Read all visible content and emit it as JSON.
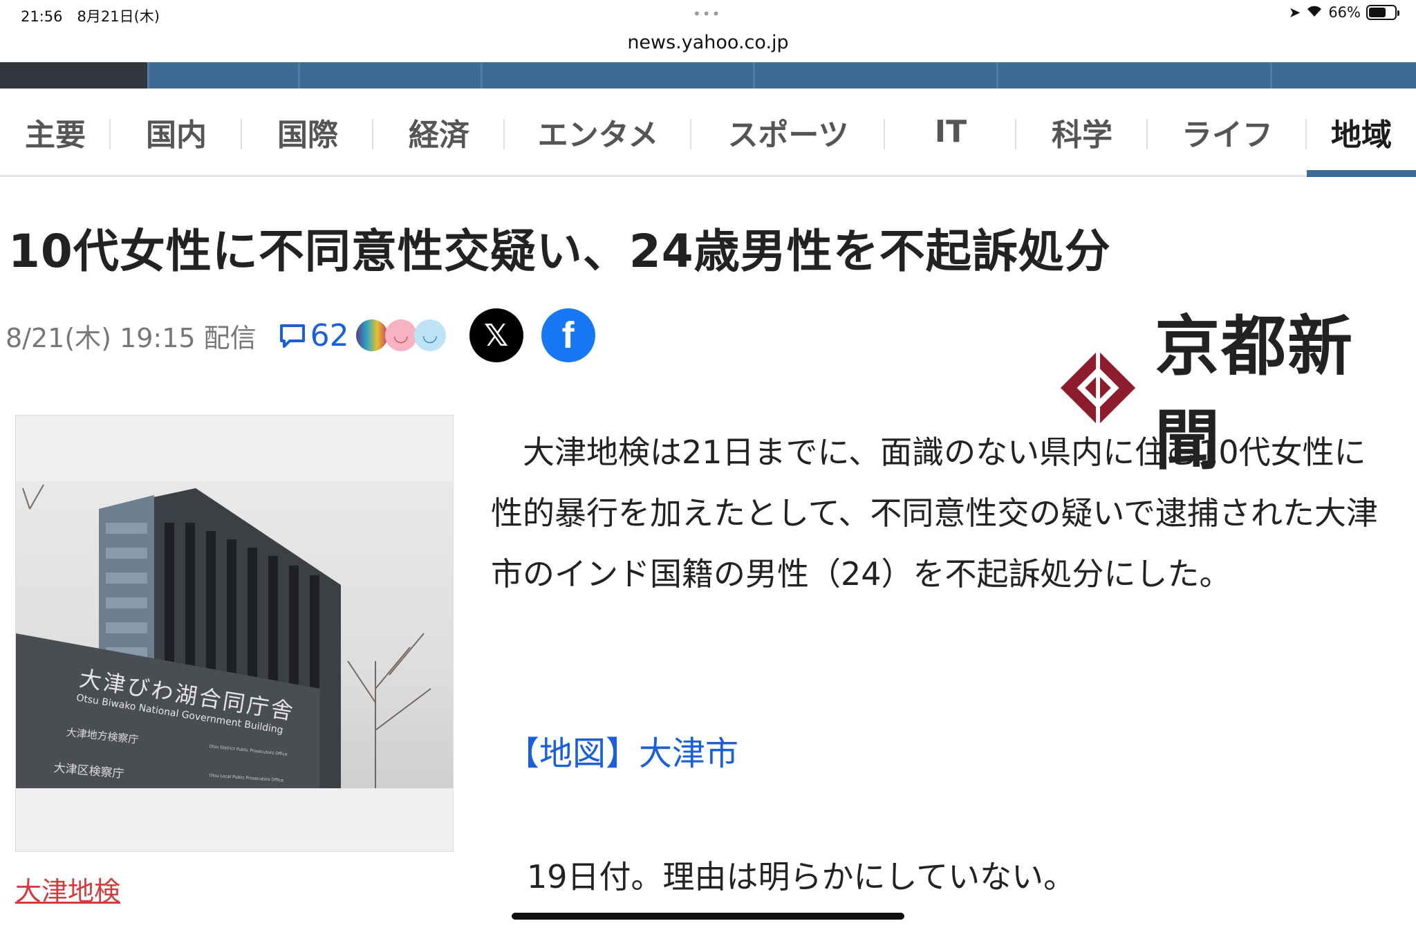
{
  "status": {
    "time_date": "21:56　8月21日(木)",
    "battery": "66%",
    "battery_level": 0.66
  },
  "browser": {
    "url": "news.yahoo.co.jp"
  },
  "tabs": [
    "主要",
    "国内",
    "国際",
    "経済",
    "エンタメ",
    "スポーツ",
    "IT",
    "科学",
    "ライフ",
    "地域"
  ],
  "active_tab": "地域",
  "article": {
    "headline": "10代女性に不同意性交疑い、24歳男性を不起訴処分",
    "date": "8/21(木) 19:15 配信",
    "comment_count": "62",
    "publisher": "京都新聞",
    "image_caption": "大津地検",
    "paragraph1": "　大津地検は21日までに、面識のない県内に住む10代女性に性的暴行を加えたとして、不同意性交の疑いで逮捕された大津市のインド国籍の男性（24）を不起訴処分にした。",
    "map_link": "【地図】大津市",
    "paragraph2": "19日付。理由は明らかにしていない。"
  },
  "photo_sign": {
    "title": "大津びわ湖合同庁舎",
    "subtitle": "Otsu Biwako National Government Building",
    "line1": "大津地方検察庁",
    "line1_en": "Otsu District Public Prosecutors Office",
    "line2": "大津区検察庁",
    "line2_en": "Otsu Local Public Prosecutors Office"
  },
  "colors": {
    "nav_band": "#3c6c93",
    "link": "#1a5fd8",
    "caption_link": "#d23c3c",
    "logo_red": "#8e1c2c"
  }
}
